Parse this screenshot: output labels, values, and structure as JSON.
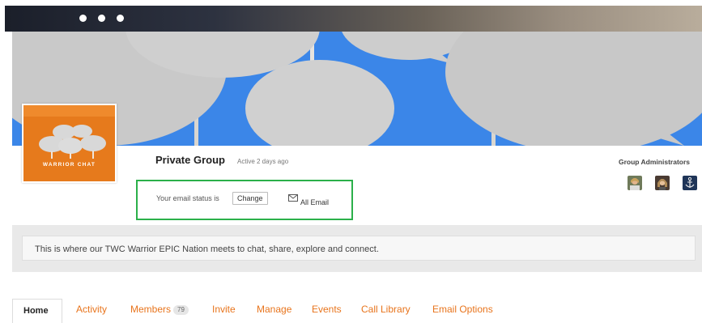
{
  "header": {
    "group_type": "Private Group",
    "activity": "Active 2 days ago"
  },
  "avatar": {
    "logo_text": "WARRIOR CHAT",
    "background": "#e67a1c"
  },
  "email_status": {
    "label": "Your email status is",
    "change_label": "Change",
    "value": "All Email",
    "icon": "mail-icon",
    "highlight_color": "#2bb04a"
  },
  "admins": {
    "title": "Group Administrators",
    "count": 3
  },
  "description": "This is where our TWC Warrior EPIC Nation meets to chat, share, explore and connect.",
  "tabs": [
    {
      "label": "Home",
      "active": true
    },
    {
      "label": "Activity"
    },
    {
      "label": "Members",
      "count": "79"
    },
    {
      "label": "Invite"
    },
    {
      "label": "Manage"
    },
    {
      "label": "Events"
    },
    {
      "label": "Call Library"
    },
    {
      "label": "Email Options"
    }
  ],
  "colors": {
    "accent": "#e8741c",
    "cover": "#3b86e8"
  }
}
